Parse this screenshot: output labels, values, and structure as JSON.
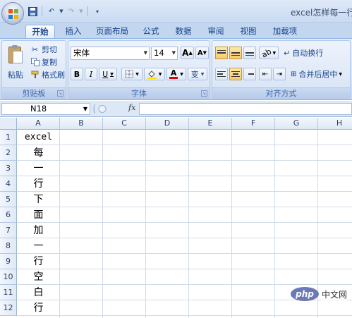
{
  "window": {
    "title": "excel怎样每一行"
  },
  "tabs": [
    "开始",
    "插入",
    "页面布局",
    "公式",
    "数据",
    "审阅",
    "视图",
    "加载项"
  ],
  "clipboard": {
    "paste_label": "粘贴",
    "cut_label": "剪切",
    "copy_label": "复制",
    "format_painter_label": "格式刷",
    "group_label": "剪贴板"
  },
  "font": {
    "font_name": "宋体",
    "font_size": "14",
    "grow_label": "A",
    "shrink_label": "A",
    "bold_label": "B",
    "italic_label": "I",
    "underline_label": "U",
    "color_label": "A",
    "phonetic_label": "变",
    "group_label": "字体"
  },
  "alignment": {
    "wrap_label": "自动换行",
    "merge_label": "合并后居中",
    "group_label": "对齐方式"
  },
  "formula_bar": {
    "name_box": "N18",
    "fx_label": "fx",
    "value": ""
  },
  "columns": [
    "A",
    "B",
    "C",
    "D",
    "E",
    "F",
    "G",
    "H"
  ],
  "rows": [
    "1",
    "2",
    "3",
    "4",
    "5",
    "6",
    "7",
    "8",
    "9",
    "10",
    "11",
    "12"
  ],
  "cells_A": [
    "excel",
    "每",
    "一",
    "行",
    "下",
    "面",
    "加",
    "一",
    "行",
    "空",
    "白",
    "行"
  ],
  "watermark": {
    "badge": "php",
    "text": "中文网"
  }
}
